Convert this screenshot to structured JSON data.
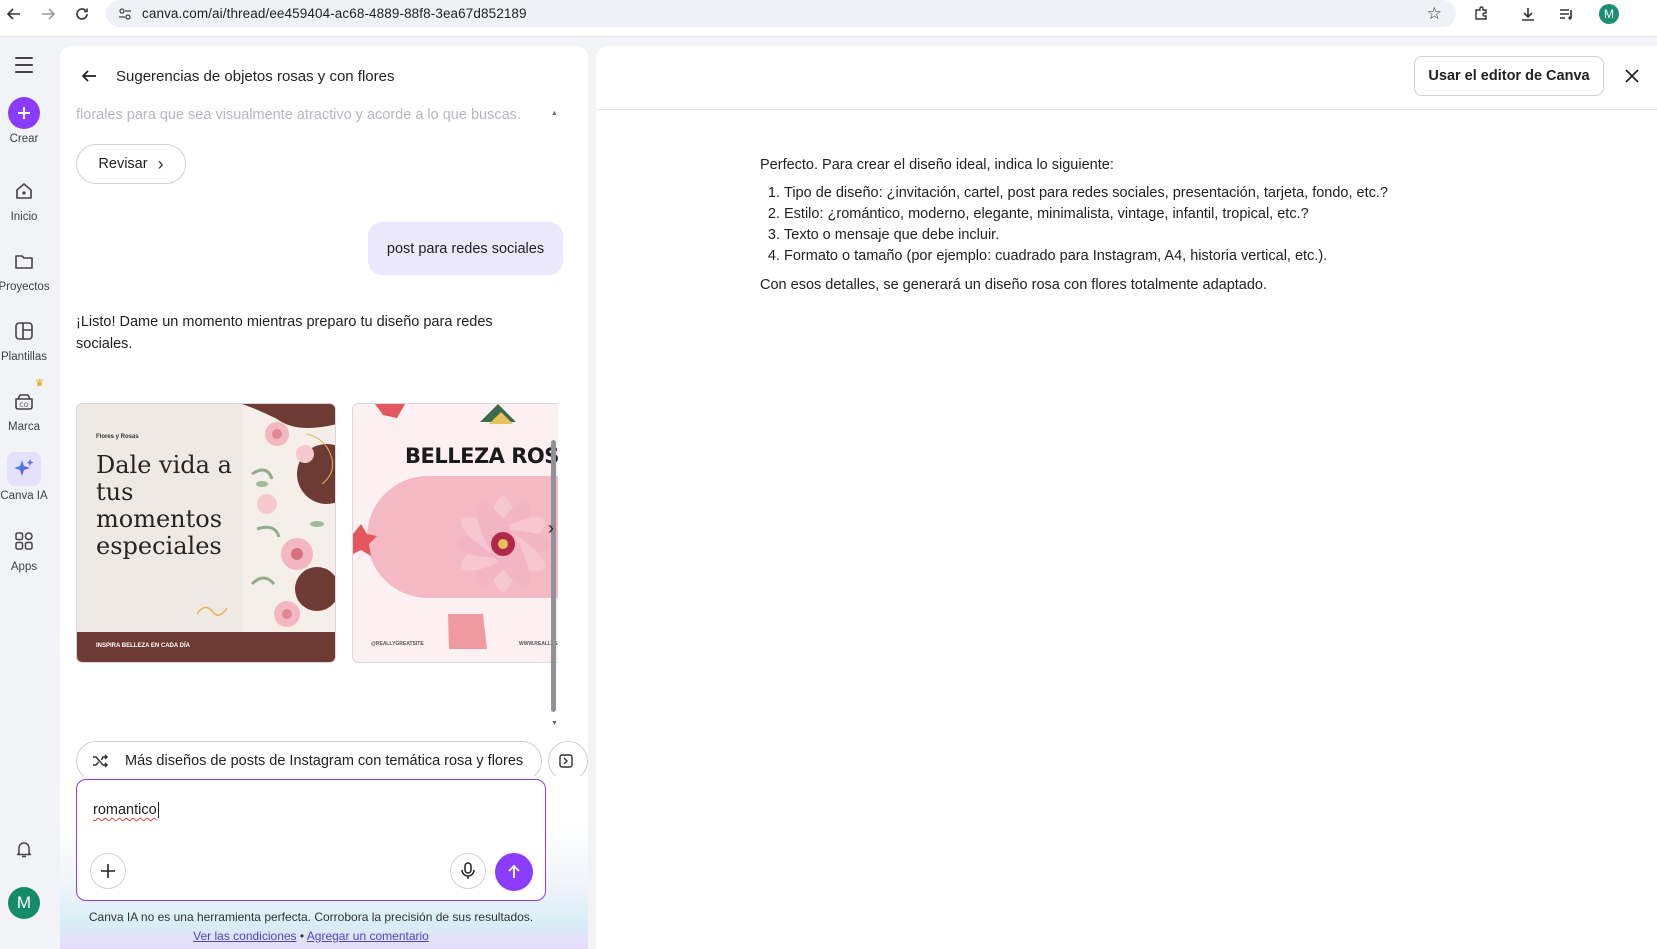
{
  "browser": {
    "url": "canva.com/ai/thread/ee459404-ac68-4889-88f8-3ea67d852189",
    "profile_initial": "M"
  },
  "rail": {
    "items": [
      {
        "label": "Crear",
        "icon": "plus-icon"
      },
      {
        "label": "Inicio",
        "icon": "home-icon"
      },
      {
        "label": "Proyectos",
        "icon": "folder-icon"
      },
      {
        "label": "Plantillas",
        "icon": "templates-icon"
      },
      {
        "label": "Marca",
        "icon": "brand-icon"
      },
      {
        "label": "Canva IA",
        "icon": "sparkle-icon"
      },
      {
        "label": "Apps",
        "icon": "apps-icon"
      }
    ],
    "user_initial": "M",
    "accent": "#8b3dff"
  },
  "chat": {
    "title": "Sugerencias de objetos rosas y con flores",
    "faded_text": "florales para que sea visualmente atractivo y acorde a lo que buscas.",
    "revisar_label": "Revisar",
    "user_message": "post para redes sociales",
    "assistant_reply": "¡Listo! Dame un momento mientras preparo tu diseño para redes sociales.",
    "cards": [
      {
        "brand": "Flores y Rosas",
        "headline": "Dale vida a tus momentos especiales",
        "footer": "INSPIRA BELLEZA EN CADA DÍA"
      },
      {
        "headline": "BELLEZA ROSA",
        "meta_left": "@REALLYGREATSITE",
        "meta_right": "WWW.REALLYG"
      }
    ],
    "suggestion": "Más diseños de posts de Instagram con temática rosa y flores",
    "composer_value": "romantico",
    "disclaimer": "Canva IA no es una herramienta perfecta. Corrobora la precisión de sus resultados.",
    "link_terms": "Ver las condiciones",
    "link_separator": "•",
    "link_feedback": "Agregar un comentario"
  },
  "preview": {
    "use_editor_label": "Usar el editor de Canva",
    "intro": "Perfecto. Para crear el diseño ideal, indica lo siguiente:",
    "items": [
      "Tipo de diseño: ¿invitación, cartel, post para redes sociales, presentación, tarjeta, fondo, etc.?",
      "Estilo: ¿romántico, moderno, elegante, minimalista, vintage, infantil, tropical, etc.?",
      "Texto o mensaje que debe incluir.",
      "Formato o tamaño (por ejemplo: cuadrado para Instagram, A4, historia vertical, etc.)."
    ],
    "outro": "Con esos detalles, se generará un diseño rosa con flores totalmente adaptado."
  }
}
